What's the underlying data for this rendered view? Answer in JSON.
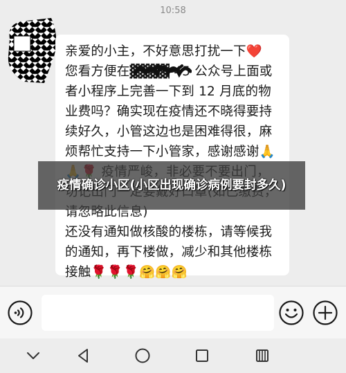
{
  "status": {
    "time": "10:58"
  },
  "message": {
    "text": "亲爱的小主，不好意思打扰一下❤️\n您看方便在▓▓▓▓ 45 公众号上面或者小程序上完善一下到 12 月底的物业费吗？确实现在疫情还不晓得要持续好久，小管这边也是困难得很，麻烦帮忙支持一下小管家，感谢感谢🙏🙏🌹 疫情严峻，非必要不要出门，切记出门一定要戴好口罩(如已缴费，请忽略此信息)\n还没有通知做核酸的楼栋，请等候我的通知，再下楼做，减少和其他楼栋接触🌹🌹🌹🤗🤗🤗"
  },
  "overlay": {
    "title": "疫情确诊小区(小区出现确诊病例要封多久)"
  },
  "input": {
    "placeholder": ""
  },
  "icons": {
    "voice": "voice-icon",
    "emoji": "emoji-icon",
    "plus": "plus-icon",
    "nav_down": "chevron-down-icon",
    "nav_back": "back-triangle-icon",
    "nav_home": "home-circle-icon",
    "nav_recent": "recent-square-icon",
    "nav_menu": "menu-icon"
  },
  "colors": {
    "background": "#ededed",
    "bubble": "#ffffff",
    "icon": "#1a1a1a"
  }
}
